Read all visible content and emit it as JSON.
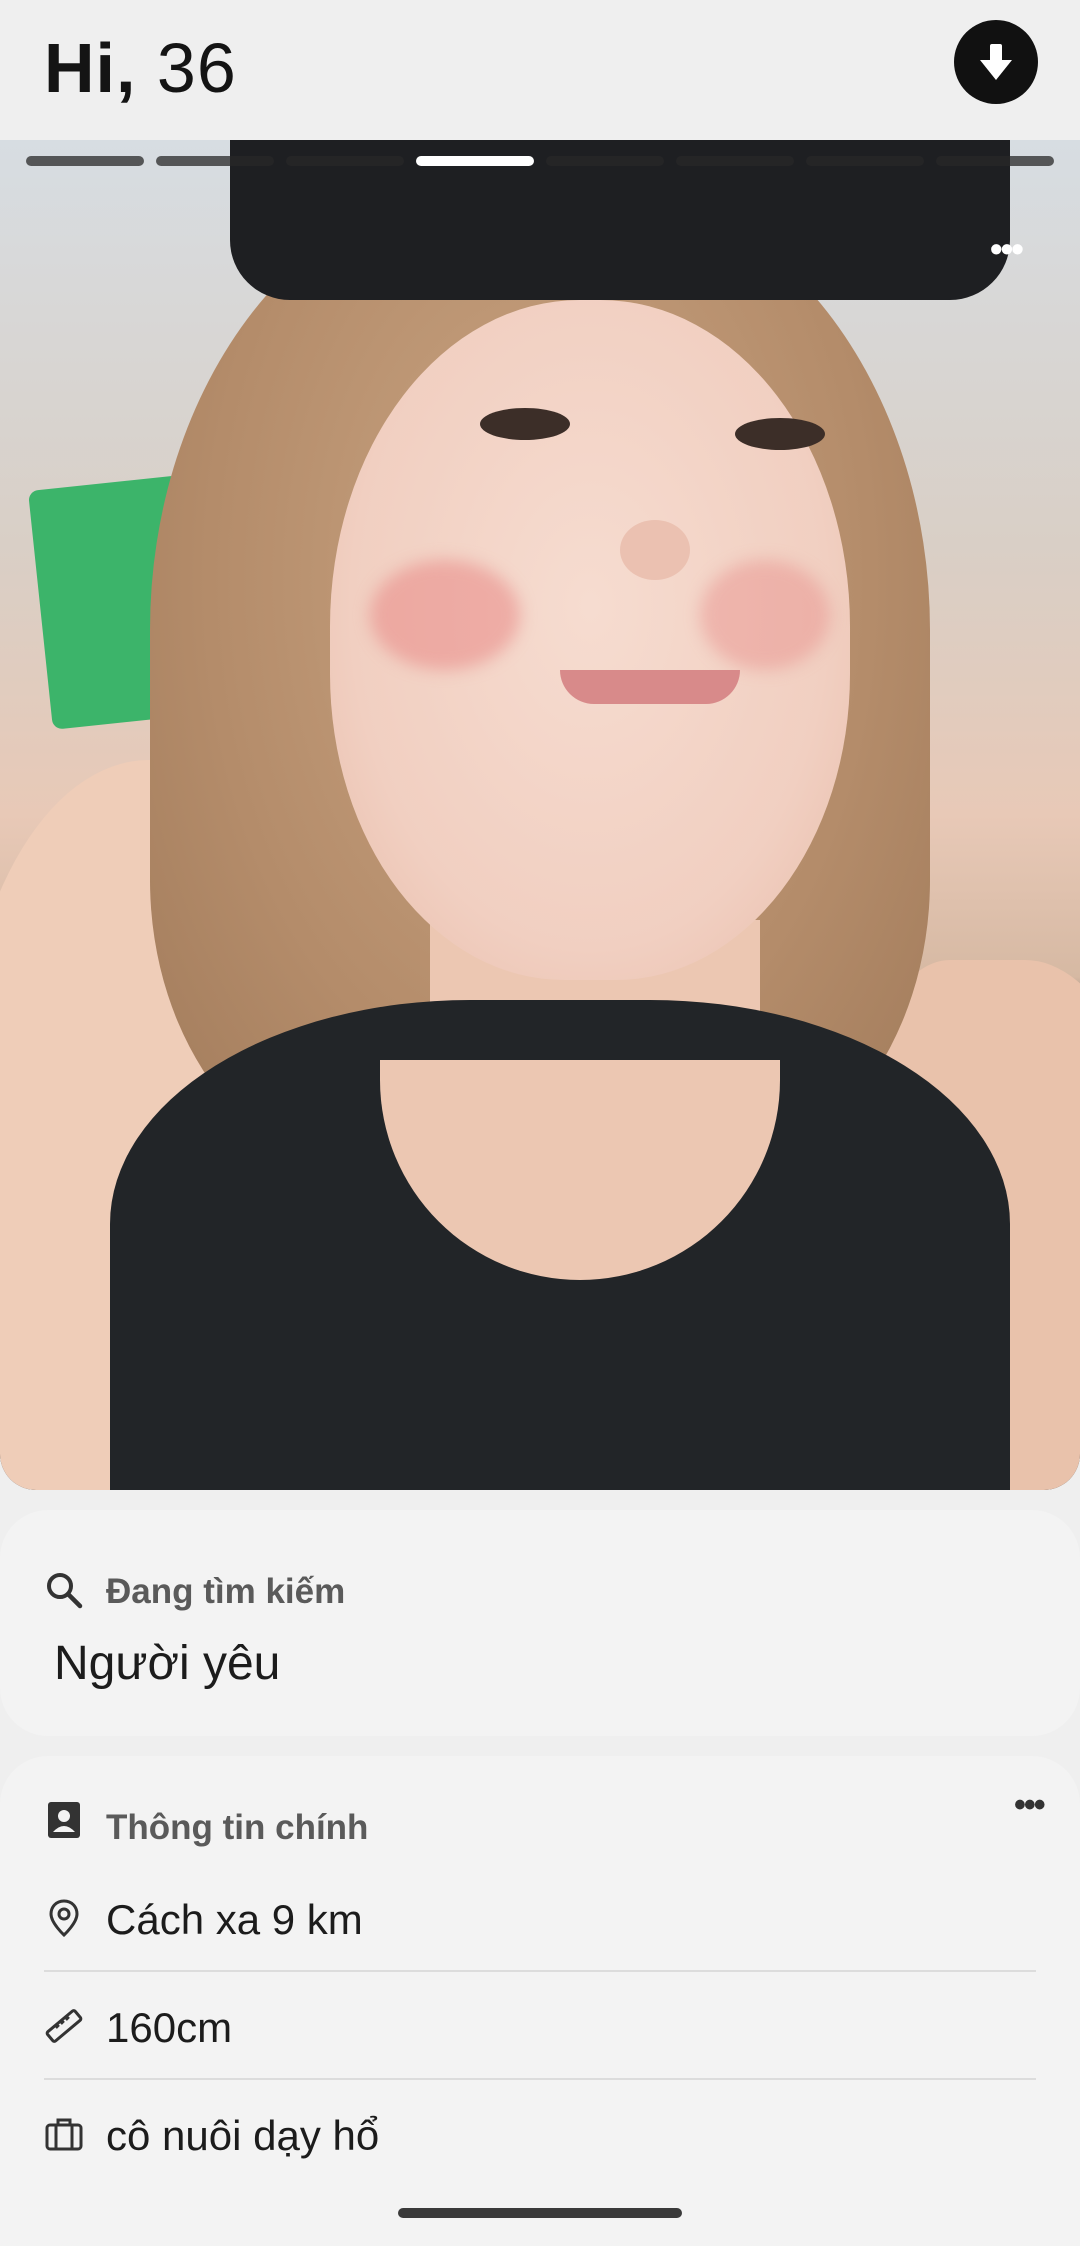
{
  "header": {
    "greeting": "Hi,",
    "number": "36",
    "download_icon": "arrow-down-circle-icon"
  },
  "photo": {
    "progress": {
      "total": 8,
      "active_index": 3
    },
    "more_icon": "more-horizontal-icon"
  },
  "looking_for": {
    "label": "Đang tìm kiếm",
    "value": "Người yêu",
    "icon": "search-icon"
  },
  "main_info": {
    "title": "Thông tin chính",
    "title_icon": "profile-card-icon",
    "more_icon": "more-horizontal-icon",
    "items": [
      {
        "icon": "location-pin-icon",
        "text": "Cách xa 9 km"
      },
      {
        "icon": "ruler-icon",
        "text": "160cm"
      },
      {
        "icon": "briefcase-icon",
        "text": "cô nuôi dạy hổ"
      }
    ]
  },
  "colors": {
    "background": "#efefef",
    "card": "#f3f3f3",
    "accent_dark": "#111111"
  }
}
